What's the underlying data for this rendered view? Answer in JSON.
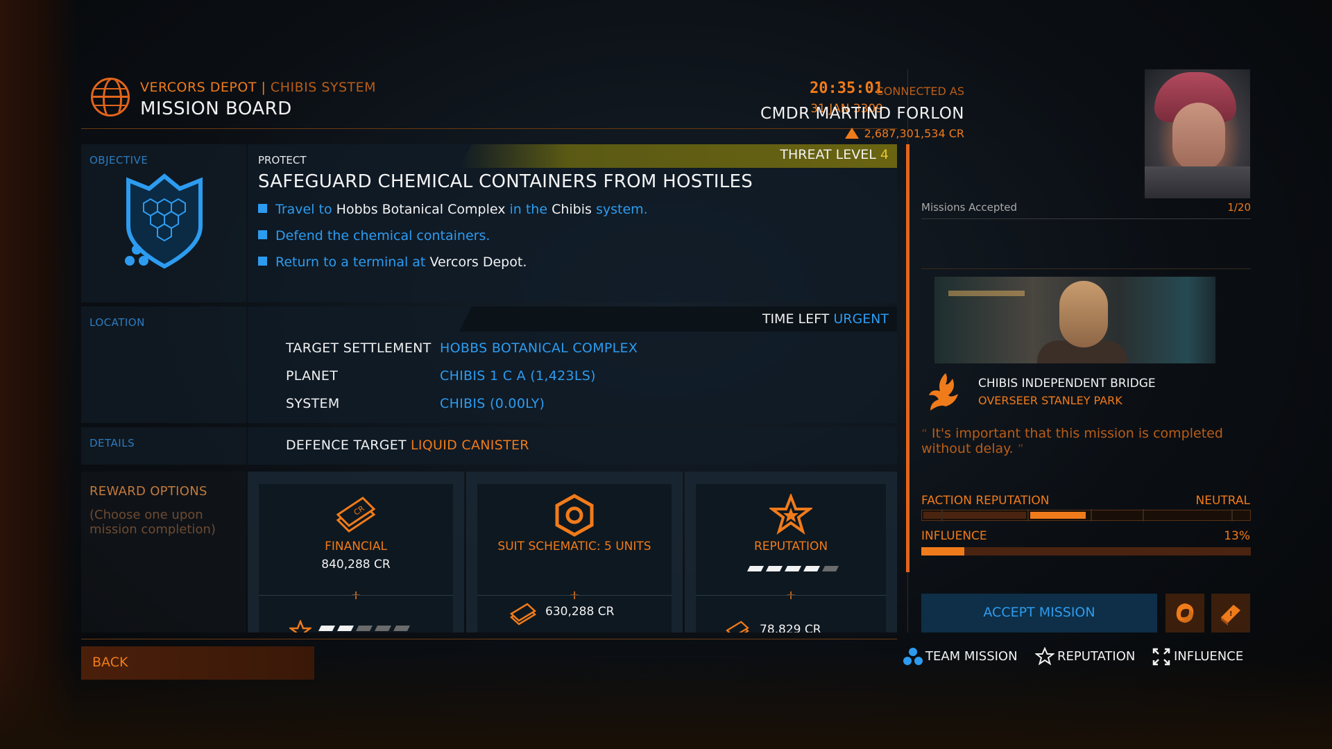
{
  "header": {
    "station": "VERCORS DEPOT",
    "separator": " | ",
    "system": "CHIBIS SYSTEM",
    "title": "MISSION BOARD",
    "time": "20:35:01",
    "date": "31 JAN 3309"
  },
  "objective": {
    "section_label": "OBJECTIVE",
    "type": "PROTECT",
    "threat_label": "THREAT LEVEL",
    "threat_value": "4",
    "title": "SAFEGUARD CHEMICAL CONTAINERS FROM HOSTILES",
    "steps": [
      {
        "a": "Travel to",
        "b": "Hobbs Botanical Complex",
        "c": "in the",
        "d": "Chibis",
        "e": "system."
      },
      {
        "a": "Defend the chemical containers."
      },
      {
        "a": "Return to a terminal at",
        "b": "Vercors Depot",
        "c": "."
      }
    ]
  },
  "location": {
    "section_label": "LOCATION",
    "time_left_label": "TIME LEFT",
    "time_left_value": "URGENT",
    "rows": [
      {
        "key": "TARGET SETTLEMENT",
        "value": "HOBBS BOTANICAL COMPLEX"
      },
      {
        "key": "PLANET",
        "value": "CHIBIS 1 C A (1,423LS)"
      },
      {
        "key": "SYSTEM",
        "value": "CHIBIS (0.00LY)"
      }
    ]
  },
  "details": {
    "section_label": "DETAILS",
    "key": "DEFENCE TARGET",
    "value": "LIQUID CANISTER"
  },
  "rewards": {
    "section_label": "REWARD OPTIONS",
    "note": "(Choose one upon mission completion)",
    "options": [
      {
        "name": "FINANCIAL",
        "value": "840,288 CR",
        "plus": "+",
        "rep_pips": 2,
        "rep_total": 5
      },
      {
        "name": "SUIT SCHEMATIC: 5 UNITS",
        "plus": "+",
        "bonus_cr": "630,288 CR"
      },
      {
        "name": "REPUTATION",
        "rep_pips": 4,
        "rep_total": 5,
        "plus": "+",
        "bonus_cr": "78,829 CR"
      }
    ]
  },
  "commander": {
    "connected_label": "CONNECTED AS",
    "name": "CMDR MARTIND FORLON",
    "credits": "2,687,301,534 CR",
    "missions_label": "Missions Accepted",
    "missions_value": "1/20"
  },
  "giver": {
    "faction": "CHIBIS INDEPENDENT BRIDGE",
    "contact": "OVERSEER STANLEY PARK",
    "quote_open": "“",
    "quote": "It's important that this mission is completed without delay.",
    "quote_close": "”",
    "faction_rep_label": "FACTION REPUTATION",
    "faction_rep_value": "NEUTRAL",
    "influence_label": "INFLUENCE",
    "influence_value": "13%",
    "influence_fraction": 0.13
  },
  "actions": {
    "accept": "ACCEPT MISSION",
    "back": "BACK"
  },
  "legend": [
    {
      "icon": "team-mission-icon",
      "label": "TEAM MISSION"
    },
    {
      "icon": "reputation-icon",
      "label": "REPUTATION"
    },
    {
      "icon": "influence-icon",
      "label": "INFLUENCE"
    }
  ],
  "colors": {
    "accent": "#f07b1b",
    "info_blue": "#2d9cf0",
    "threat_yellow": "#e6c927"
  }
}
